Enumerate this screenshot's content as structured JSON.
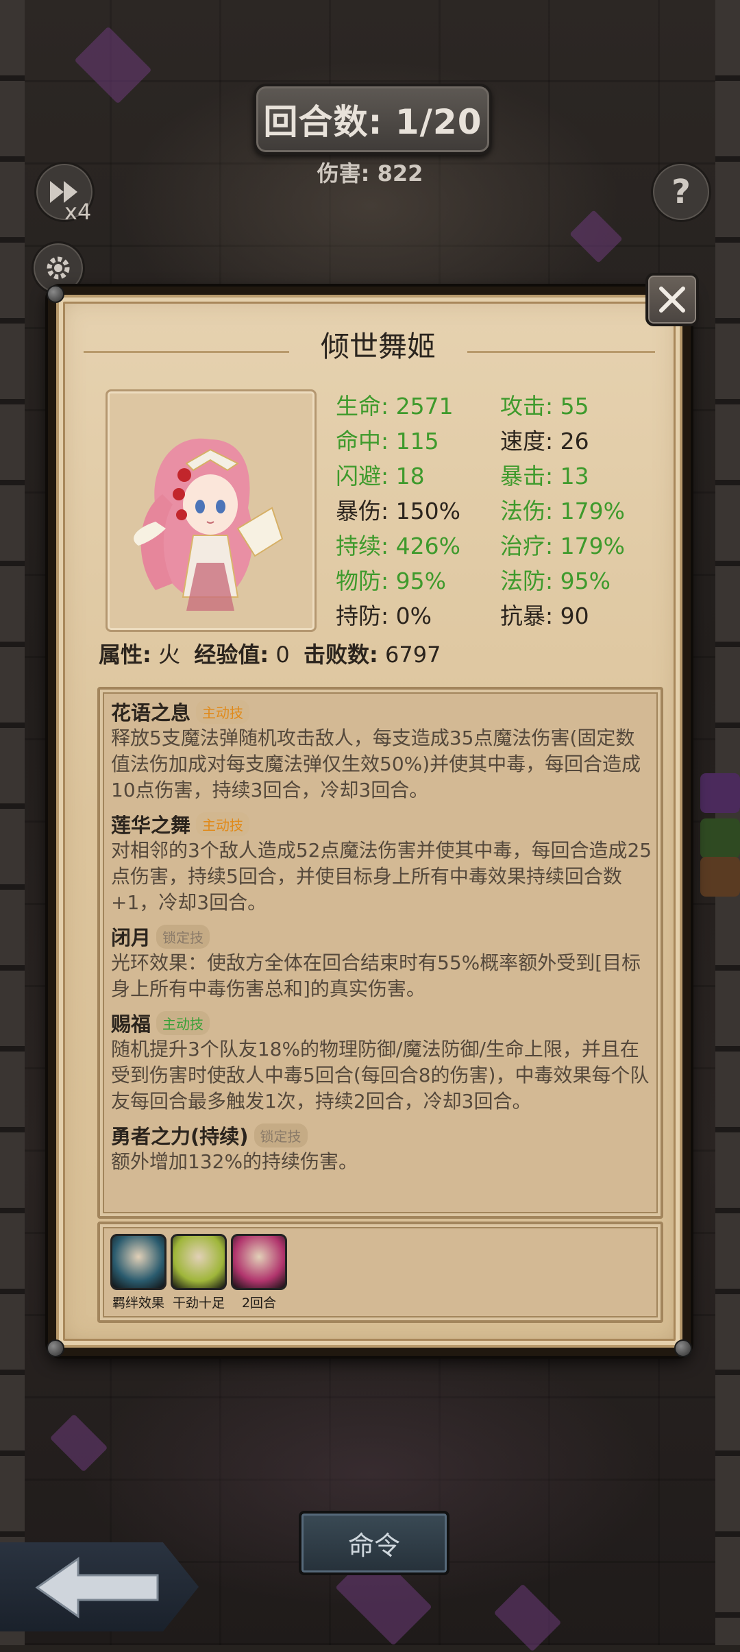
{
  "hud": {
    "round": "回合数: 1/20",
    "damage": "伤害: 822",
    "speed": "x4"
  },
  "hero": {
    "name": "倾世舞姬",
    "stats": [
      [
        {
          "label": "生命: 2571",
          "color": "green"
        },
        {
          "label": "攻击: 55",
          "color": "green"
        }
      ],
      [
        {
          "label": "命中: 115",
          "color": "green"
        },
        {
          "label": "速度: 26",
          "color": "dark"
        }
      ],
      [
        {
          "label": "闪避: 18",
          "color": "green"
        },
        {
          "label": "暴击: 13",
          "color": "green"
        }
      ],
      [
        {
          "label": "暴伤: 150%",
          "color": "dark"
        },
        {
          "label": "法伤: 179%",
          "color": "green"
        }
      ],
      [
        {
          "label": "持续: 426%",
          "color": "green"
        },
        {
          "label": "治疗: 179%",
          "color": "green"
        }
      ],
      [
        {
          "label": "物防: 95%",
          "color": "green"
        },
        {
          "label": "法防: 95%",
          "color": "green"
        }
      ],
      [
        {
          "label": "持防: 0%",
          "color": "dark"
        },
        {
          "label": "抗暴: 90",
          "color": "dark"
        }
      ]
    ],
    "attr_label": "属性:",
    "attr_value": "火",
    "exp_label": "经验值:",
    "exp_value": "0",
    "kills_label": "击败数:",
    "kills_value": "6797"
  },
  "skills": [
    {
      "name": "花语之息",
      "tag": "主动技",
      "tag_type": "active-orange",
      "desc": "释放5支魔法弹随机攻击敌人，每支造成35点魔法伤害(固定数值法伤加成对每支魔法弹仅生效50%)并使其中毒，每回合造成10点伤害，持续3回合，冷却3回合。"
    },
    {
      "name": "莲华之舞",
      "tag": "主动技",
      "tag_type": "active-orange",
      "desc": "对相邻的3个敌人造成52点魔法伤害并使其中毒，每回合造成25点伤害，持续5回合，并使目标身上所有中毒效果持续回合数+1，冷却3回合。"
    },
    {
      "name": "闭月",
      "tag": "锁定技",
      "tag_type": "locked",
      "desc": "光环效果：使敌方全体在回合结束时有55%概率额外受到[目标身上所有中毒伤害总和]的真实伤害。"
    },
    {
      "name": "赐福",
      "tag": "主动技",
      "tag_type": "active-green",
      "desc": "随机提升3个队友18%的物理防御/魔法防御/生命上限，并且在受到伤害时使敌人中毒5回合(每回合8的伤害)，中毒效果每个队友每回合最多触发1次，持续2回合，冷却3回合。"
    },
    {
      "name": "勇者之力(持续)",
      "tag": "锁定技",
      "tag_type": "locked",
      "desc": "额外增加132%的持续伤害。"
    }
  ],
  "items": [
    {
      "label": "羁绊效果",
      "icon": "bond-crystal-icon",
      "color": "#2a5b6e"
    },
    {
      "label": "干劲十足",
      "icon": "motivated-face-icon",
      "color": "#9fb63a"
    },
    {
      "label": "2回合",
      "icon": "potion-icon",
      "color": "#b1356d"
    }
  ],
  "bottom": {
    "command": "命令"
  },
  "colors": {
    "stat_green": "#3e9a2c",
    "tag_orange": "#e08a1a",
    "tag_green": "#38a138",
    "parchment": "#dcc49c"
  }
}
